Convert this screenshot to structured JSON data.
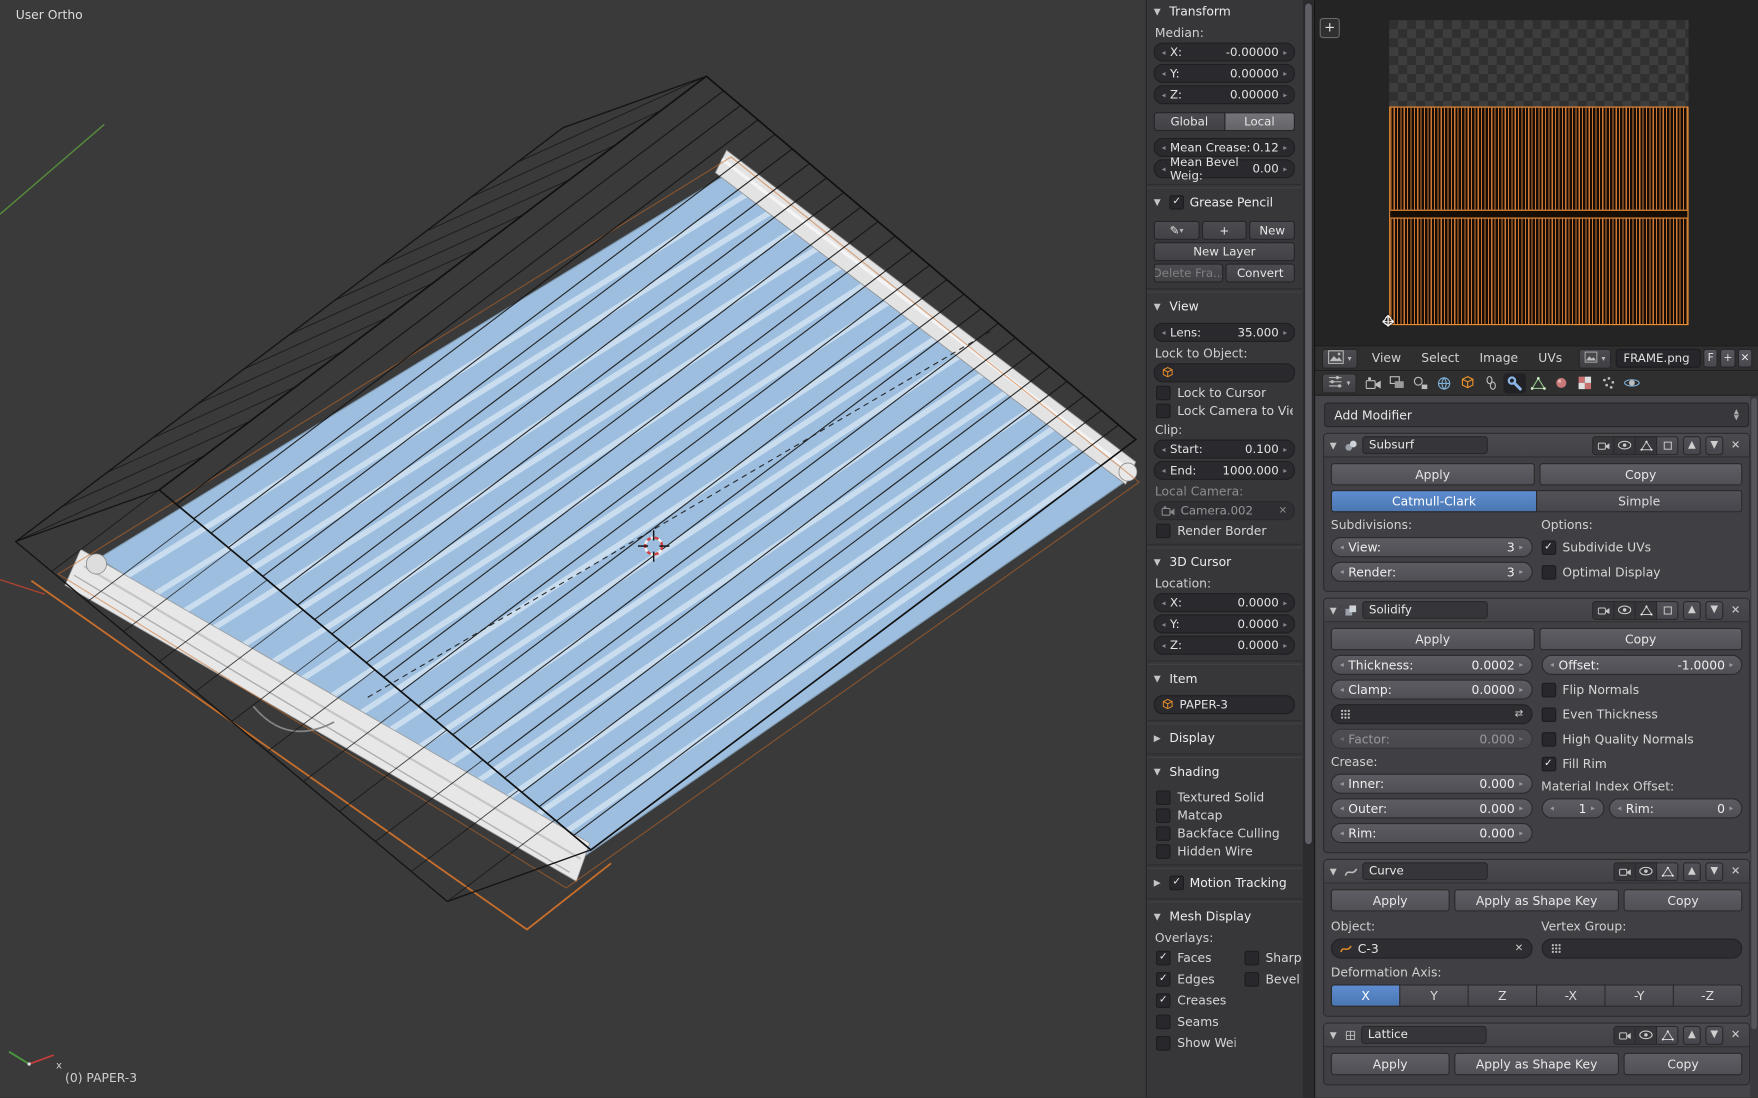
{
  "colors": {
    "accent_orange": "#e8902a",
    "accent_blue": "#4a77b4"
  },
  "viewport": {
    "view_mode": "User Ortho",
    "status": "(0) PAPER-3",
    "axis_x": "x"
  },
  "npanel": {
    "transform": {
      "title": "Transform",
      "median_label": "Median:",
      "x_label": "X:",
      "x_value": "-0.00000",
      "y_label": "Y:",
      "y_value": "0.00000",
      "z_label": "Z:",
      "z_value": "0.00000",
      "global_label": "Global",
      "local_label": "Local",
      "crease_label": "Mean Crease:",
      "crease_value": "0.12",
      "bevel_label": "Mean Bevel Weig:",
      "bevel_value": "0.00"
    },
    "grease_pencil": {
      "title": "Grease Pencil",
      "check": "✓",
      "new_label": "New",
      "new_layer_label": "New Layer",
      "delete_frame_label": "Delete Fra...",
      "convert_label": "Convert"
    },
    "view": {
      "title": "View",
      "lens_label": "Lens:",
      "lens_value": "35.000",
      "lock_object_label": "Lock to Object:",
      "lock_cursor_label": "Lock to Cursor",
      "lock_camera_label": "Lock Camera to View",
      "clip_label": "Clip:",
      "start_label": "Start:",
      "start_value": "0.100",
      "end_label": "End:",
      "end_value": "1000.000",
      "local_camera_label": "Local Camera:",
      "camera_value": "Camera.002",
      "render_border_label": "Render Border"
    },
    "cursor3d": {
      "title": "3D Cursor",
      "location_label": "Location:",
      "x_label": "X:",
      "x_value": "0.0000",
      "y_label": "Y:",
      "y_value": "0.0000",
      "z_label": "Z:",
      "z_value": "0.0000"
    },
    "item": {
      "title": "Item",
      "name": "PAPER-3"
    },
    "display": {
      "title": "Display"
    },
    "shading": {
      "title": "Shading",
      "checks": [
        {
          "label": "Textured Solid",
          "check": ""
        },
        {
          "label": "Matcap",
          "check": ""
        },
        {
          "label": "Backface Culling",
          "check": ""
        },
        {
          "label": "Hidden Wire",
          "check": ""
        }
      ]
    },
    "motion_tracking": {
      "title": "Motion Tracking",
      "check": "✓"
    },
    "mesh_display": {
      "title": "Mesh Display",
      "overlays_label": "Overlays:",
      "checks": [
        {
          "label": "Faces",
          "check": "✓"
        },
        {
          "label": "Sharp",
          "check": ""
        },
        {
          "label": "Edges",
          "check": "✓"
        },
        {
          "label": "Bevel",
          "check": ""
        },
        {
          "label": "Creases",
          "check": "✓"
        },
        {
          "label": "Seams",
          "check": ""
        },
        {
          "label": "Show Weights",
          "check": ""
        }
      ]
    }
  },
  "uv_editor": {
    "add_region": "+",
    "menus": {
      "view": "View",
      "select": "Select",
      "image": "Image",
      "uvs": "UVs"
    },
    "image_name": "FRAME.png",
    "fake_user": "F",
    "new_image": "+",
    "unlink": "✕"
  },
  "properties": {
    "add_modifier": "Add Modifier",
    "subsurf": {
      "name": "Subsurf",
      "apply": "Apply",
      "copy": "Copy",
      "catmull": "Catmull-Clark",
      "simple": "Simple",
      "subdivisions_label": "Subdivisions:",
      "options_label": "Options:",
      "view_label": "View:",
      "view_value": "3",
      "render_label": "Render:",
      "render_value": "3",
      "subdivide_uvs": {
        "label": "Subdivide UVs",
        "check": "✓"
      },
      "optimal": {
        "label": "Optimal Display",
        "check": ""
      }
    },
    "solidify": {
      "name": "Solidify",
      "apply": "Apply",
      "copy": "Copy",
      "thickness_label": "Thickness:",
      "thickness_value": "0.0002",
      "offset_label": "Offset:",
      "offset_value": "-1.0000",
      "clamp_label": "Clamp:",
      "clamp_value": "0.0000",
      "factor_label": "Factor:",
      "factor_value": "0.000",
      "crease_label": "Crease:",
      "inner_label": "Inner:",
      "inner_value": "0.000",
      "outer_label": "Outer:",
      "outer_value": "0.000",
      "rim_label": "Rim:",
      "rim_value": "0.000",
      "flip": {
        "label": "Flip Normals",
        "check": ""
      },
      "even": {
        "label": "Even Thickness",
        "check": ""
      },
      "hq": {
        "label": "High Quality Normals",
        "check": ""
      },
      "fill_rim": {
        "label": "Fill Rim",
        "check": "✓"
      },
      "mat_index_label": "Material Index Offset:",
      "mat_index_value": "1",
      "rim_idx_label": "Rim:",
      "rim_idx_value": "0"
    },
    "curve": {
      "name": "Curve",
      "apply": "Apply",
      "apply_shape": "Apply as Shape Key",
      "copy": "Copy",
      "object_label": "Object:",
      "object_value": "C-3",
      "vgroup_label": "Vertex Group:",
      "deform_label": "Deformation Axis:",
      "axes": [
        {
          "label": "X"
        },
        {
          "label": "Y"
        },
        {
          "label": "Z"
        },
        {
          "label": "-X"
        },
        {
          "label": "-Y"
        },
        {
          "label": "-Z"
        }
      ]
    },
    "lattice": {
      "name": "Lattice",
      "apply": "Apply",
      "apply_shape": "Apply as Shape Key",
      "copy": "Copy"
    }
  }
}
